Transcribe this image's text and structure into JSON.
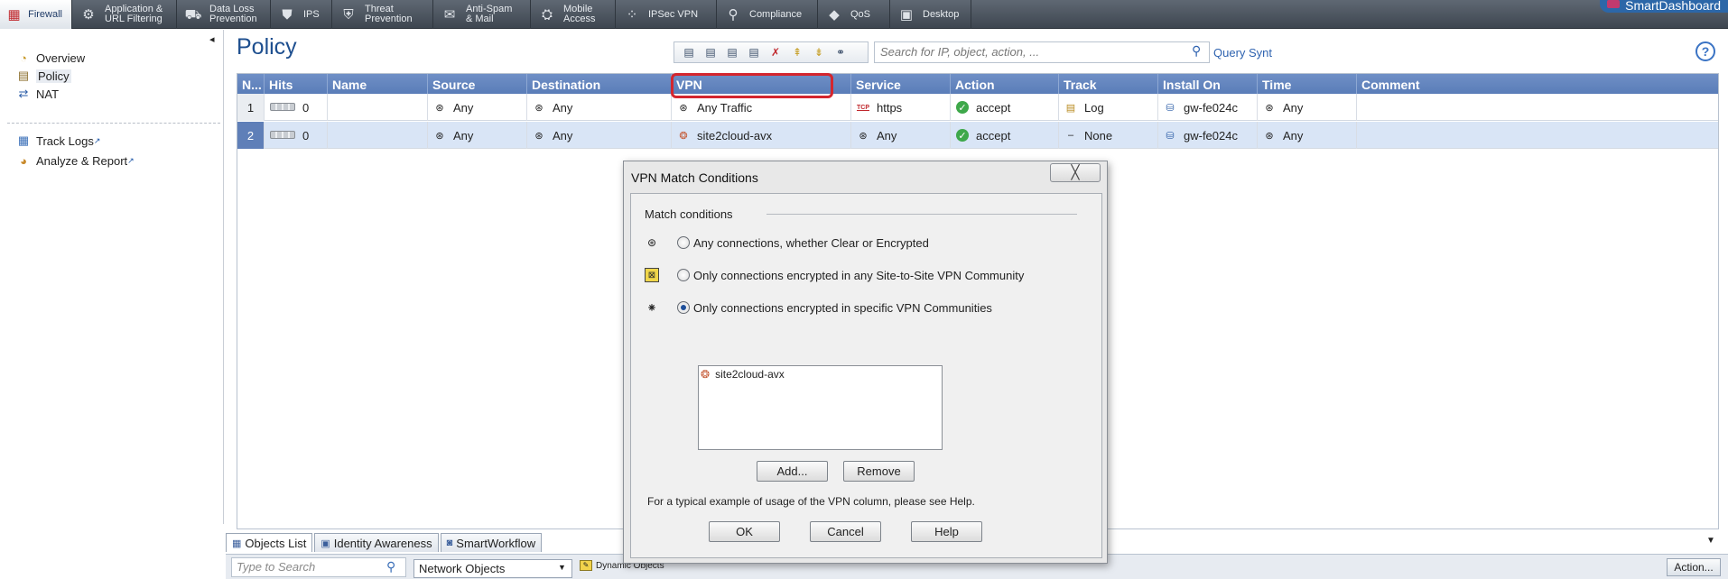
{
  "topbar": {
    "tabs": [
      {
        "label": "Firewall",
        "icon": "firewall-icon",
        "glyph": "▦"
      },
      {
        "label": "Application &\nURL Filtering",
        "icon": "application-icon",
        "glyph": "⚙"
      },
      {
        "label": "Data Loss\nPrevention",
        "icon": "dlp-icon",
        "glyph": "⛟"
      },
      {
        "label": "IPS",
        "icon": "ips-shield-icon",
        "glyph": "⛊"
      },
      {
        "label": "Threat\nPrevention",
        "icon": "threat-icon",
        "glyph": "⛨"
      },
      {
        "label": "Anti-Spam\n& Mail",
        "icon": "mail-icon",
        "glyph": "✉"
      },
      {
        "label": "Mobile\nAccess",
        "icon": "mobile-icon",
        "glyph": "⛭"
      },
      {
        "label": "IPSec VPN",
        "icon": "vpn-icon",
        "glyph": "⁘"
      },
      {
        "label": "Compliance",
        "icon": "compliance-icon",
        "glyph": "⚲"
      },
      {
        "label": "QoS",
        "icon": "qos-icon",
        "glyph": "◆"
      },
      {
        "label": "Desktop",
        "icon": "desktop-icon",
        "glyph": "▣"
      }
    ],
    "brand": "SmartDashboard"
  },
  "leftnav": {
    "items": [
      {
        "label": "Overview",
        "glyph": "◔"
      },
      {
        "label": "Policy",
        "glyph": "▤"
      },
      {
        "label": "NAT",
        "glyph": "⇄"
      }
    ],
    "links": [
      {
        "label": "Track Logs",
        "glyph": "▦"
      },
      {
        "label": "Analyze & Report",
        "glyph": "◕"
      }
    ],
    "collapse": "◂"
  },
  "main": {
    "title": "Policy",
    "search_placeholder": "Search for IP, object, action, ...",
    "query_syntax": "Query Synt",
    "help": "?"
  },
  "grid": {
    "columns": [
      "N...",
      "Hits",
      "Name",
      "Source",
      "Destination",
      "VPN",
      "Service",
      "Action",
      "Track",
      "Install On",
      "Time",
      "Comment"
    ],
    "rows": [
      {
        "num": "1",
        "hits": "0",
        "name": "",
        "source": "Any",
        "destination": "Any",
        "vpn": "Any Traffic",
        "service": "https",
        "service_tag": "TCP",
        "action": "accept",
        "track": "Log",
        "install_on": "gw-fe024c",
        "time": "Any",
        "comment": ""
      },
      {
        "num": "2",
        "hits": "0",
        "name": "",
        "source": "Any",
        "destination": "Any",
        "vpn": "site2cloud-avx",
        "service": "Any",
        "service_tag": "",
        "action": "accept",
        "track": "None",
        "install_on": "gw-fe024c",
        "time": "Any",
        "comment": ""
      }
    ]
  },
  "bottom": {
    "tabs": [
      "Objects List",
      "Identity Awareness",
      "SmartWorkflow"
    ],
    "search_placeholder": "Type to Search",
    "network_objects": "Network Objects",
    "dynamic_objects": "Dynamic Objects",
    "action_button": "Action..."
  },
  "dialog": {
    "title": "VPN Match Conditions",
    "close": "╳",
    "section": "Match conditions",
    "options": [
      {
        "label": "Any connections, whether Clear or Encrypted",
        "selected": false
      },
      {
        "label": "Only connections encrypted in any Site-to-Site VPN Community",
        "selected": false
      },
      {
        "label": "Only connections encrypted in specific VPN Communities",
        "selected": true
      }
    ],
    "communities": [
      "site2cloud-avx"
    ],
    "add_button": "Add...",
    "remove_button": "Remove",
    "hint": "For a typical example of usage of the VPN column, please see Help.",
    "ok_button": "OK",
    "cancel_button": "Cancel",
    "help_button": "Help"
  }
}
